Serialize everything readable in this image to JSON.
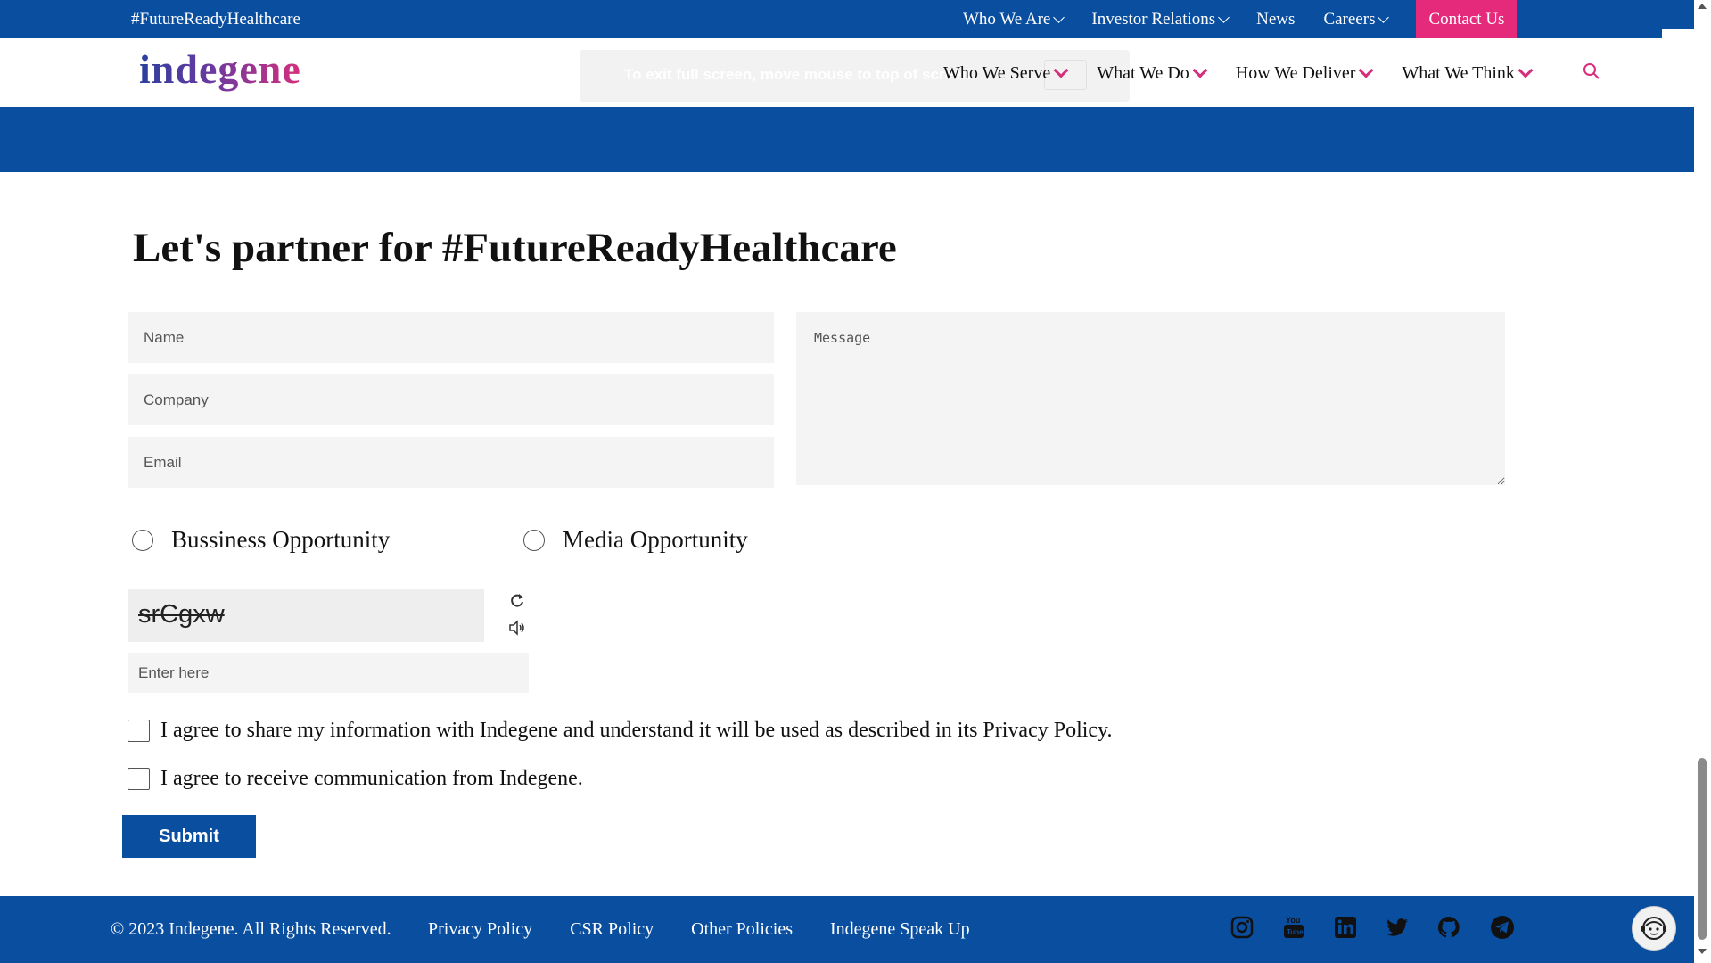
{
  "topbar": {
    "hashtag": "#FutureReadyHealthcare",
    "nav": [
      {
        "label": "Who We Are",
        "has_dropdown": true
      },
      {
        "label": "Investor Relations",
        "has_dropdown": true
      },
      {
        "label": "News",
        "has_dropdown": false
      },
      {
        "label": "Careers",
        "has_dropdown": true
      }
    ],
    "contact_label": "Contact Us"
  },
  "header": {
    "logo": "indegene",
    "fullscreen_toast": "To exit full screen, move mouse to top of screen",
    "nav": [
      {
        "label": "Who We Serve"
      },
      {
        "label": "What We Do"
      },
      {
        "label": "How We Deliver"
      },
      {
        "label": "What We Think"
      }
    ]
  },
  "form": {
    "title": "Let's partner for #FutureReadyHealthcare",
    "name_placeholder": "Name",
    "company_placeholder": "Company",
    "email_placeholder": "Email",
    "message_placeholder": "Message",
    "radio_options": [
      "Bussiness Opportunity",
      "Media Opportunity"
    ],
    "captcha_text": "srCgxw",
    "captcha_input_placeholder": "Enter here",
    "consent_privacy": "I agree to share my information with Indegene and understand it will be used as described in its Privacy Policy.",
    "consent_communication": "I agree to receive communication from Indegene.",
    "submit_label": "Submit"
  },
  "footer": {
    "copyright": "© 2023 Indegene. All Rights Reserved.",
    "links": [
      "Privacy Policy",
      "CSR Policy",
      "Other Policies",
      "Indegene Speak Up"
    ],
    "social_icons": [
      "instagram-icon",
      "youtube-icon",
      "linkedin-icon",
      "twitter-icon",
      "github-icon",
      "telegram-icon"
    ]
  },
  "colors": {
    "primary_blue": "#0a4ea0",
    "accent_pink": "#e5297b"
  }
}
